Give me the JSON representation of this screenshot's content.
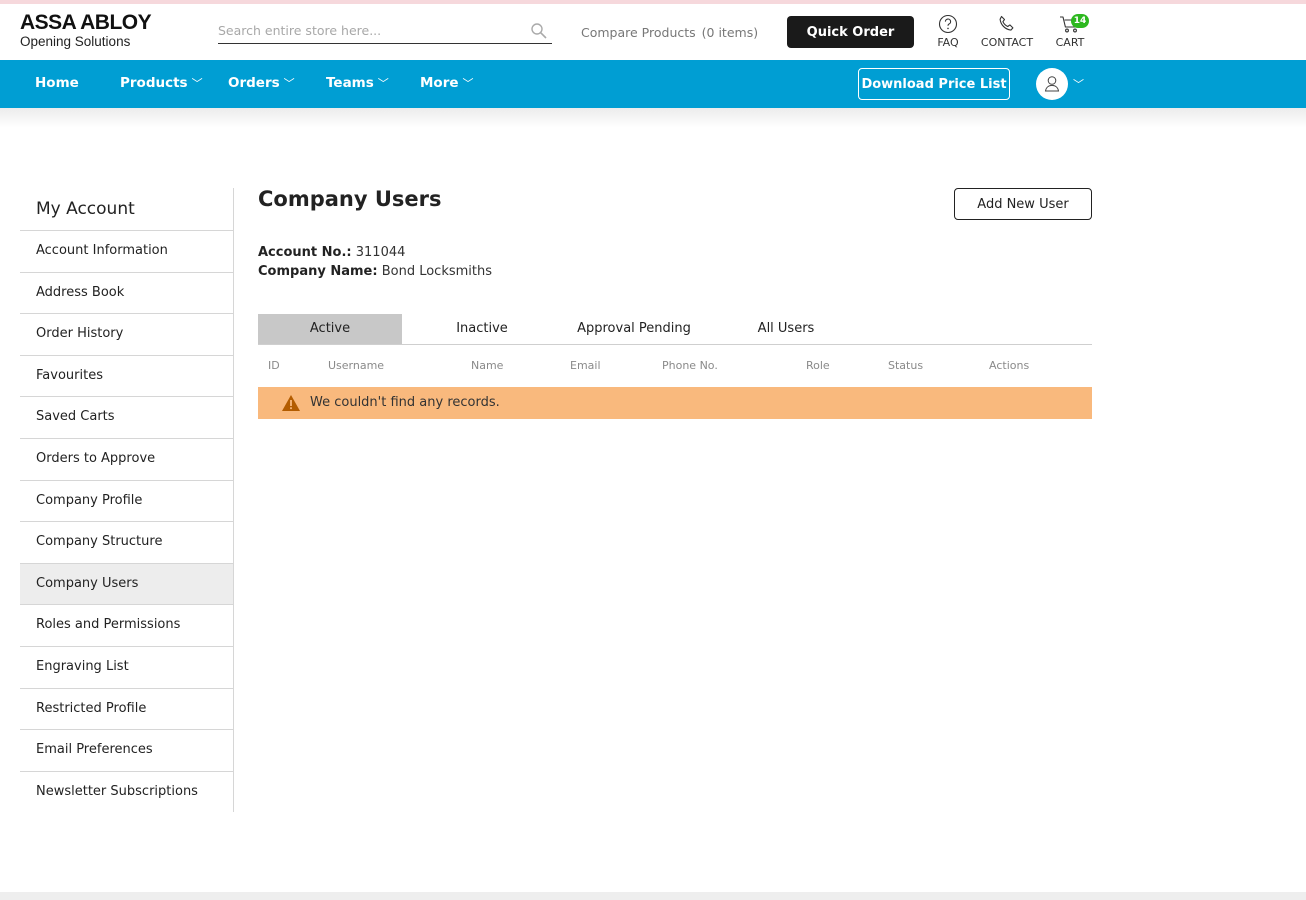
{
  "header": {
    "logo_main": "ASSA ABLOY",
    "logo_sub": "Opening Solutions",
    "search_placeholder": "Search entire store here...",
    "compare_label": "Compare Products",
    "compare_count": "(0 items)",
    "quick_order": "Quick Order",
    "faq": "FAQ",
    "contact": "CONTACT",
    "cart": "CART",
    "cart_count": "14"
  },
  "nav": {
    "items": [
      {
        "label": "Home",
        "has_dropdown": false
      },
      {
        "label": "Products",
        "has_dropdown": true
      },
      {
        "label": "Orders",
        "has_dropdown": true
      },
      {
        "label": "Teams",
        "has_dropdown": true
      },
      {
        "label": "More",
        "has_dropdown": true
      }
    ],
    "download_price_list": "Download Price List"
  },
  "sidebar": {
    "title": "My Account",
    "items": [
      {
        "label": "Account Information"
      },
      {
        "label": "Address Book"
      },
      {
        "label": "Order History"
      },
      {
        "label": "Favourites"
      },
      {
        "label": "Saved Carts"
      },
      {
        "label": "Orders to Approve"
      },
      {
        "label": "Company Profile"
      },
      {
        "label": "Company Structure"
      },
      {
        "label": "Company Users",
        "active": true
      },
      {
        "label": "Roles and Permissions"
      },
      {
        "label": "Engraving List"
      },
      {
        "label": "Restricted Profile"
      },
      {
        "label": "Email Preferences"
      },
      {
        "label": "Newsletter Subscriptions"
      }
    ]
  },
  "main": {
    "title": "Company Users",
    "add_user": "Add New User",
    "account_no_label": "Account No.:",
    "account_no": "311044",
    "company_name_label": "Company Name:",
    "company_name": "Bond Locksmiths",
    "tabs": [
      {
        "label": "Active",
        "active": true
      },
      {
        "label": "Inactive"
      },
      {
        "label": "Approval Pending"
      },
      {
        "label": "All Users"
      }
    ],
    "columns": [
      "ID",
      "Username",
      "Name",
      "Email",
      "Phone No.",
      "Role",
      "Status",
      "Actions"
    ],
    "empty_message": "We couldn't find any records."
  },
  "colors": {
    "nav_bg": "#009ed3",
    "alert_bg": "#f9b97d",
    "cart_badge": "#2db81f",
    "active_tab": "#c8c8c8"
  }
}
